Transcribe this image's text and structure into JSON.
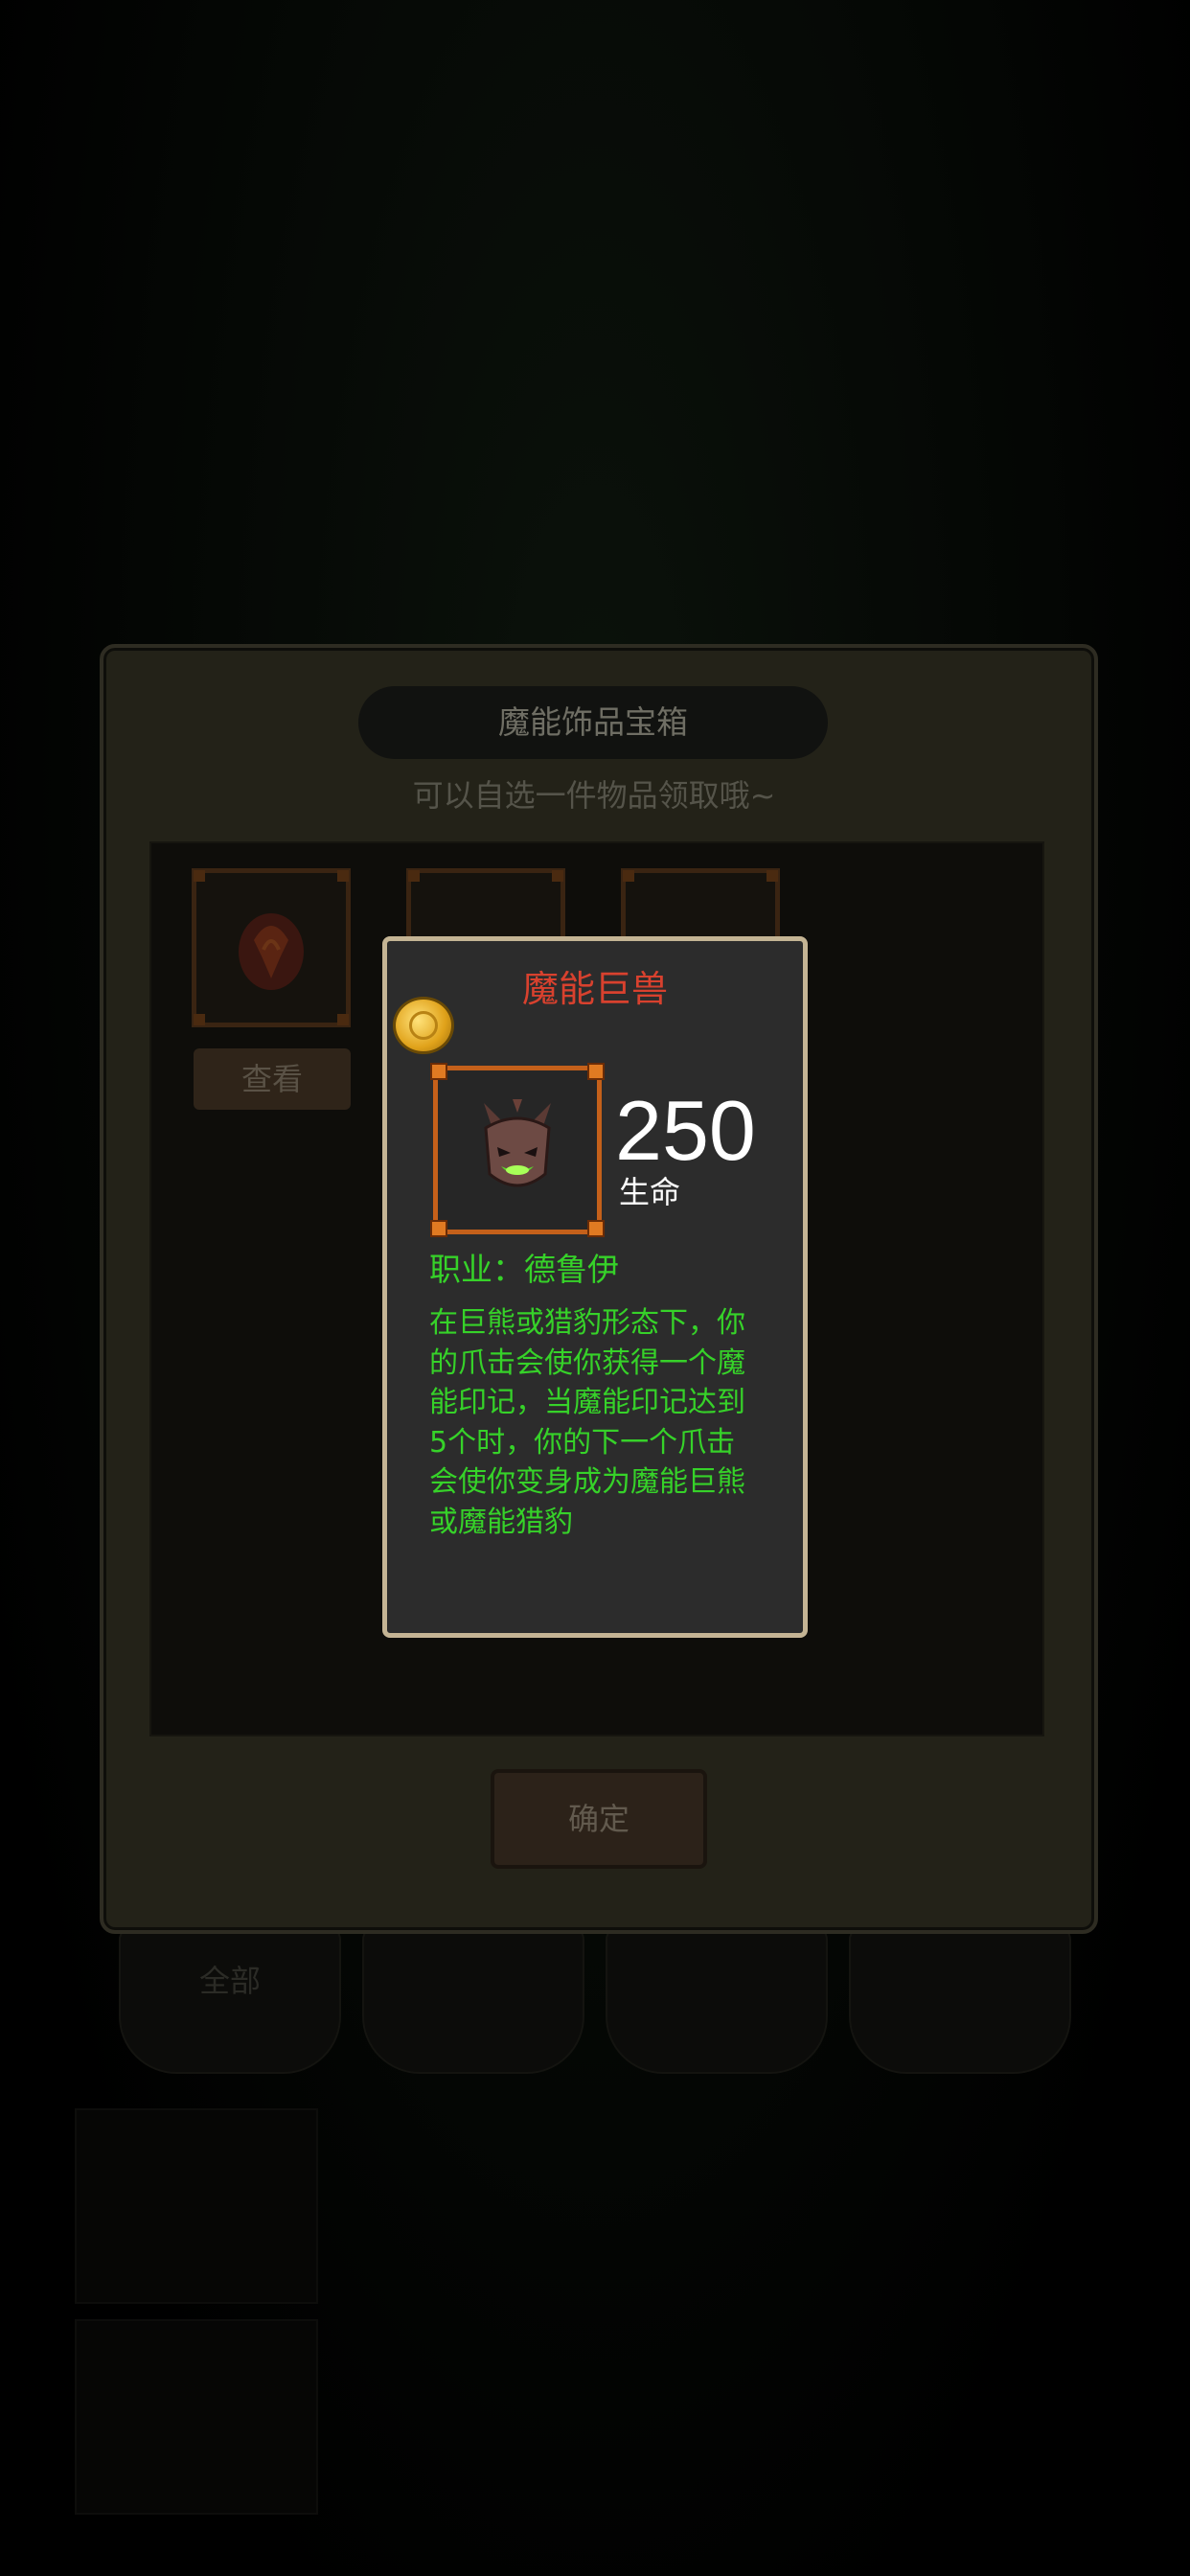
{
  "chest": {
    "title": "魔能饰品宝箱",
    "subtitle": "可以自选一件物品领取哦~",
    "view_button": "查看",
    "confirm_button": "确定"
  },
  "background_tabs": [
    "全部",
    "",
    "",
    ""
  ],
  "item_popup": {
    "name": "魔能巨兽",
    "stat_value": "250",
    "stat_label": "生命",
    "class_line": "职业：德鲁伊",
    "description": "在巨熊或猎豹形态下，你的爪击会使你获得一个魔能印记，当魔能印记达到5个时，你的下一个爪击会使你变身成为魔能巨熊或魔能猎豹",
    "icons": {
      "coin": "gold-coin-icon",
      "item": "demon-beast-mask-icon"
    }
  },
  "colors": {
    "item_name": "#d8412e",
    "effect_text": "#36d229",
    "frame_border": "#c4601a",
    "popup_border": "#c4b494"
  }
}
